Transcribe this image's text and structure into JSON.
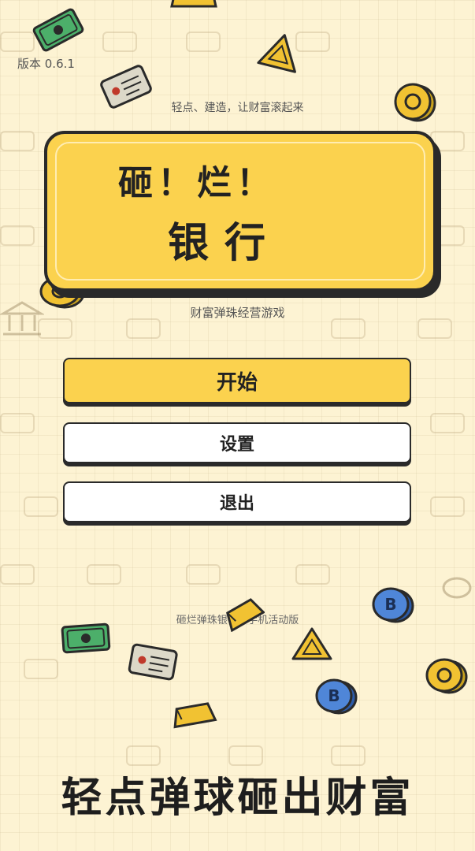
{
  "version": "版本 0.6.1",
  "tagline": "轻点、建造，让财富滚起来",
  "title": {
    "line1": "砸！烂！",
    "line2": "银行"
  },
  "subtitle": "财富弹珠经营游戏",
  "menu": {
    "start_label": "开始",
    "settings_label": "设置",
    "exit_label": "退出"
  },
  "footer_small": "砸烂弹珠银行 · 手机活动版",
  "slogan": "轻点弹球砸出财富",
  "colors": {
    "accent_yellow": "#fbd24e",
    "outline": "#2a2a2a",
    "background": "#fdf3d3"
  }
}
